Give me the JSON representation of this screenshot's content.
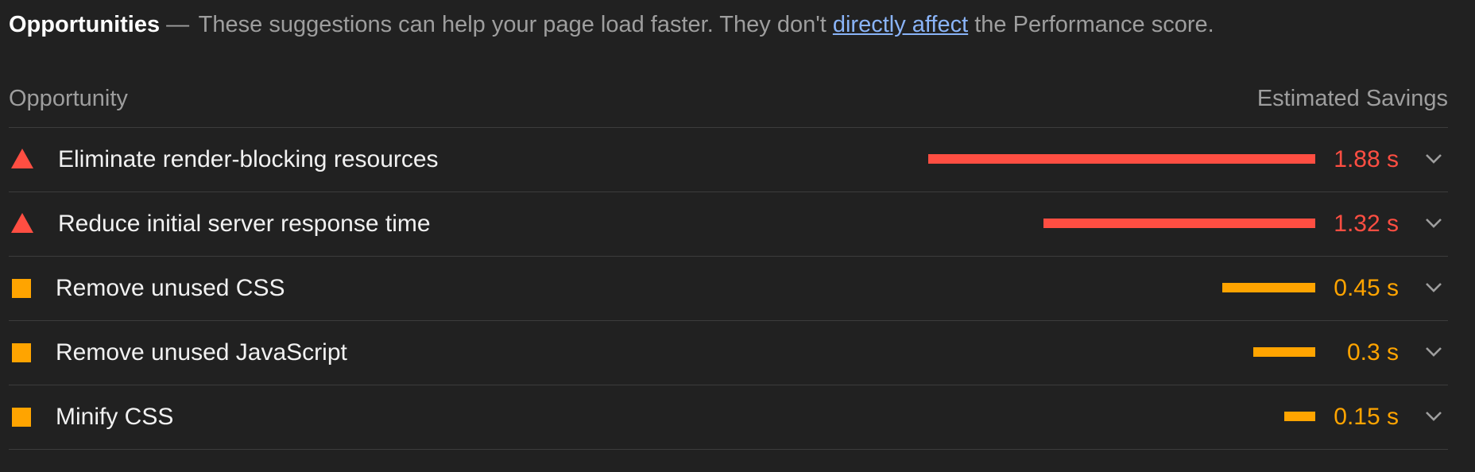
{
  "header": {
    "title": "Opportunities",
    "separator": "—",
    "desc_before": "These suggestions can help your page load faster. They don't",
    "link_text": "directly affect",
    "desc_after": "the Performance score."
  },
  "columns": {
    "left": "Opportunity",
    "right": "Estimated Savings"
  },
  "colors": {
    "fail": "#ff4e42",
    "average": "#ffa400",
    "link": "#8ab4f8",
    "background": "#212121"
  },
  "max_savings_s": 1.88,
  "rows": [
    {
      "label": "Eliminate render-blocking resources",
      "value": "1.88 s",
      "savings_s": 1.88,
      "status": "fail",
      "icon": "triangle-fail-icon"
    },
    {
      "label": "Reduce initial server response time",
      "value": "1.32 s",
      "savings_s": 1.32,
      "status": "fail",
      "icon": "triangle-fail-icon"
    },
    {
      "label": "Remove unused CSS",
      "value": "0.45 s",
      "savings_s": 0.45,
      "status": "average",
      "icon": "square-average-icon"
    },
    {
      "label": "Remove unused JavaScript",
      "value": "0.3 s",
      "savings_s": 0.3,
      "status": "average",
      "icon": "square-average-icon"
    },
    {
      "label": "Minify CSS",
      "value": "0.15 s",
      "savings_s": 0.15,
      "status": "average",
      "icon": "square-average-icon"
    }
  ]
}
